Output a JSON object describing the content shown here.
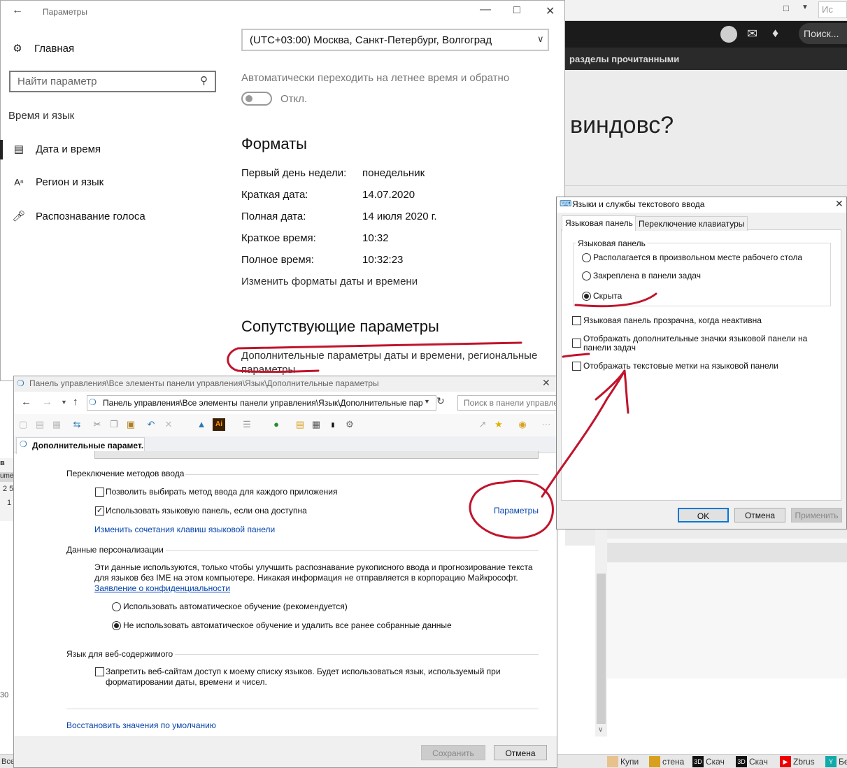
{
  "browser": {
    "search_placeholder": "Ис",
    "search_button": "Поиск...",
    "nav_strip_text": "разделы прочитанными",
    "question_heading": "виндовс?"
  },
  "settings": {
    "title": "Параметры",
    "nav": {
      "home": "Главная",
      "search_placeholder": "Найти параметр",
      "section": "Время и язык",
      "items": [
        {
          "label": "Дата и время",
          "icon": "calendar-clock-icon",
          "selected": true
        },
        {
          "label": "Регион и язык",
          "icon": "language-icon",
          "selected": false
        },
        {
          "label": "Распознавание голоса",
          "icon": "microphone-icon",
          "selected": false
        }
      ]
    },
    "timezone_value": "(UTC+03:00) Москва, Санкт-Петербург, Волгоград",
    "dst_label": "Автоматически переходить на летнее время и обратно",
    "dst_toggle_state": "Откл.",
    "formats_heading": "Форматы",
    "formats": [
      {
        "label": "Первый день недели:",
        "value": "понедельник"
      },
      {
        "label": "Краткая дата:",
        "value": "14.07.2020"
      },
      {
        "label": "Полная дата:",
        "value": "14 июля 2020 г."
      },
      {
        "label": "Краткое время:",
        "value": "10:32"
      },
      {
        "label": "Полное время:",
        "value": "10:32:23"
      }
    ],
    "change_formats_link": "Изменить форматы даты и времени",
    "related_heading": "Сопутствующие параметры",
    "related_link_line1": "Дополнительные параметры даты и времени, региональные",
    "related_link_line2": "параметры"
  },
  "control_panel": {
    "title": "Панель управления\\Все элементы панели управления\\Язык\\Дополнительные параметры",
    "address": "Панель управления\\Все элементы панели управления\\Язык\\Дополнительные пар",
    "search_placeholder": "Поиск в панели управле",
    "tab_label": "Дополнительные парамет...",
    "section_switch": "Переключение методов ввода",
    "chk_per_app": {
      "label": "Позволить выбирать метод ввода для каждого приложения",
      "checked": false
    },
    "chk_langbar": {
      "label": "Использовать языковую панель, если она доступна",
      "checked": true
    },
    "params_link": "Параметры",
    "hotkeys_link": "Изменить сочетания клавиш языковой панели",
    "section_personal": "Данные персонализации",
    "personal_text_line1": "Эти данные используются, только чтобы улучшить распознавание рукописного ввода и прогнозирование текста",
    "personal_text_line2": "для языков без IME на этом компьютере. Никакая информация не отправляется в корпорацию Майкрософт.",
    "privacy_link": "Заявление о конфиденциальности",
    "radio_auto": {
      "label": "Использовать автоматическое обучение (рекомендуется)",
      "selected": false
    },
    "radio_no_auto": {
      "label": "Не использовать автоматическое обучение и удалить все ранее собранные данные",
      "selected": true
    },
    "section_web": "Язык для веб-содержимого",
    "chk_web_line1": "Запретить веб-сайтам доступ к моему списку языков. Будет использоваться язык, используемый при",
    "chk_web_line2": "форматировании даты, времени и чисел.",
    "restore_link": "Восстановить значения по умолчанию",
    "save_button": "Сохранить",
    "cancel_button": "Отмена"
  },
  "lang_dialog": {
    "title": "Языки и службы текстового ввода",
    "tabs": [
      "Языковая панель",
      "Переключение клавиатуры"
    ],
    "group_label": "Языковая панель",
    "radios": [
      {
        "label": "Располагается в произвольном месте рабочего стола",
        "selected": false
      },
      {
        "label": "Закреплена в панели задач",
        "selected": false
      },
      {
        "label": "Скрыта",
        "selected": true
      }
    ],
    "chk_transparent": {
      "label": "Языковая панель прозрачна, когда неактивна",
      "checked": false
    },
    "chk_extra_icons_line1": "Отображать дополнительные значки языковой панели на",
    "chk_extra_icons_line2": "панели задач",
    "chk_text_labels": {
      "label": "Отображать текстовые метки на языковой панели",
      "checked": false
    },
    "ok_button": "OK",
    "cancel_button": "Отмена",
    "apply_button": "Применить"
  },
  "taskbar": {
    "items": [
      "Купи",
      "стена",
      "Скач",
      "Скач",
      "Zbrus",
      "Бе"
    ],
    "left_fragment": "Все"
  },
  "left_edge_fragments": [
    "в",
    "ume",
    "2 5",
    "1",
    "30"
  ],
  "colors": {
    "link_blue": "#0645ad",
    "annotation_red": "#c0142c",
    "accent": "#0078d7"
  }
}
